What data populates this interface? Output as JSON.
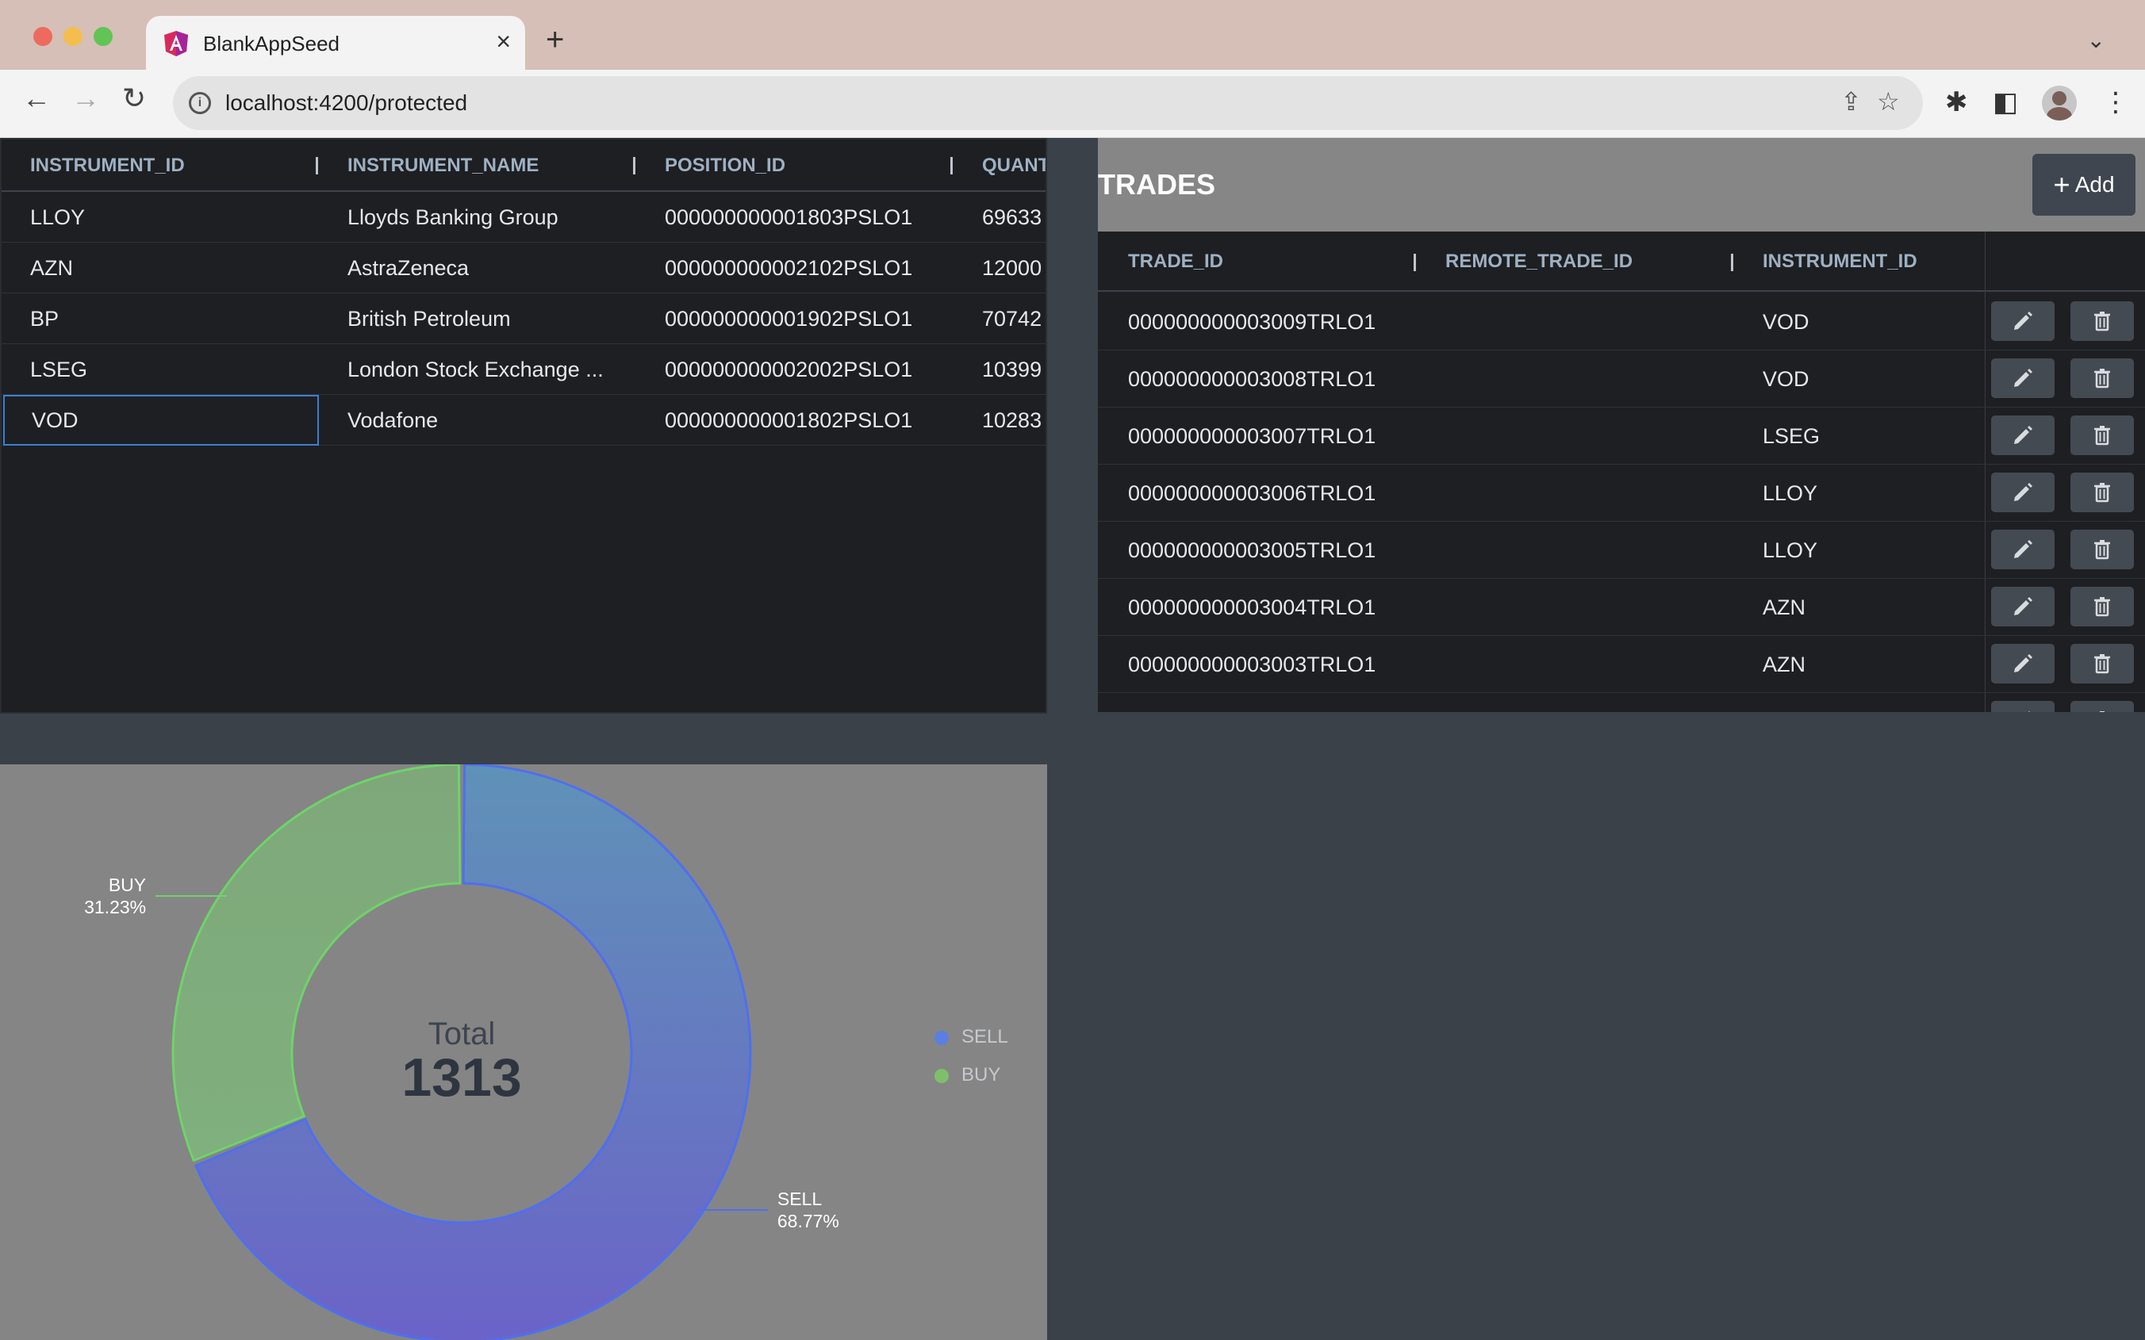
{
  "browser": {
    "tab_title": "BlankAppSeed",
    "url": "localhost:4200/protected"
  },
  "positions": {
    "columns": [
      "INSTRUMENT_ID",
      "INSTRUMENT_NAME",
      "POSITION_ID",
      "QUANT"
    ],
    "rows": [
      {
        "instrument_id": "LLOY",
        "instrument_name": "Lloyds Banking Group",
        "position_id": "000000000001803PSLO1",
        "quantity": "69633"
      },
      {
        "instrument_id": "AZN",
        "instrument_name": "AstraZeneca",
        "position_id": "000000000002102PSLO1",
        "quantity": "12000"
      },
      {
        "instrument_id": "BP",
        "instrument_name": "British Petroleum",
        "position_id": "000000000001902PSLO1",
        "quantity": "70742"
      },
      {
        "instrument_id": "LSEG",
        "instrument_name": "London Stock Exchange ...",
        "position_id": "000000000002002PSLO1",
        "quantity": "10399"
      },
      {
        "instrument_id": "VOD",
        "instrument_name": "Vodafone",
        "position_id": "000000000001802PSLO1",
        "quantity": "10283"
      }
    ]
  },
  "trades": {
    "title": "TRADES",
    "add_label": "Add",
    "columns": [
      "TRADE_ID",
      "REMOTE_TRADE_ID",
      "INSTRUMENT_ID"
    ],
    "rows": [
      {
        "trade_id": "000000000003009TRLO1",
        "remote_trade_id": "",
        "instrument_id": "VOD"
      },
      {
        "trade_id": "000000000003008TRLO1",
        "remote_trade_id": "",
        "instrument_id": "VOD"
      },
      {
        "trade_id": "000000000003007TRLO1",
        "remote_trade_id": "",
        "instrument_id": "LSEG"
      },
      {
        "trade_id": "000000000003006TRLO1",
        "remote_trade_id": "",
        "instrument_id": "LLOY"
      },
      {
        "trade_id": "000000000003005TRLO1",
        "remote_trade_id": "",
        "instrument_id": "LLOY"
      },
      {
        "trade_id": "000000000003004TRLO1",
        "remote_trade_id": "",
        "instrument_id": "AZN"
      },
      {
        "trade_id": "000000000003003TRLO1",
        "remote_trade_id": "",
        "instrument_id": "AZN"
      }
    ]
  },
  "chart_data": {
    "type": "pie",
    "center_label": "Total",
    "center_value": "1313",
    "series": [
      {
        "name": "SELL",
        "value": 68.77,
        "label": "68.77%",
        "color": "#5b7fe0"
      },
      {
        "name": "BUY",
        "value": 31.23,
        "label": "31.23%",
        "color": "#7fbf6a"
      }
    ],
    "legend": [
      "SELL",
      "BUY"
    ],
    "legend_position": "right"
  }
}
